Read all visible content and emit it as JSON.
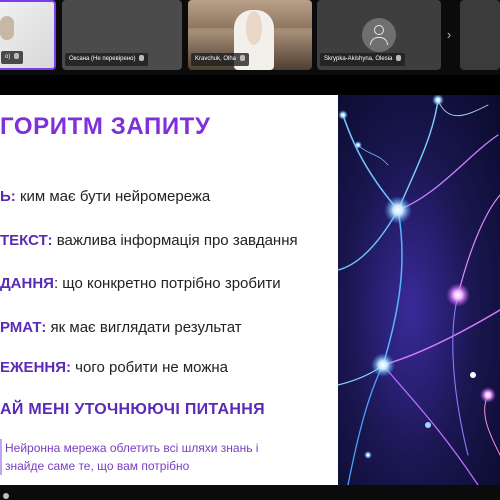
{
  "participants": [
    {
      "name": "o)"
    },
    {
      "name": "Оксана (Не перевірено)"
    },
    {
      "name": "Kravchuk, Olha"
    },
    {
      "name": "Skrypka-Akishyna, Olesia"
    }
  ],
  "strip_next": "›",
  "slide": {
    "title": "ГОРИТМ ЗАПИТУ",
    "rows": [
      {
        "key": "Ь:",
        "text": " ким має бути нейромережа"
      },
      {
        "key": "ТЕКСТ:",
        "text": " важлива інформація про завдання"
      },
      {
        "key": "ДАННЯ",
        "text": ": що конкретно потрібно зробити"
      },
      {
        "key": "РМАТ:",
        "text": " як має виглядати результат"
      },
      {
        "key": "ЕЖЕННЯ:",
        "text": " чого робити не можна"
      }
    ],
    "cta": "АЙ МЕНІ УТОЧНЮЮЧІ ПИТАННЯ",
    "note_line1": "Нейронна мережа облетить всі шляхи знань і",
    "note_line2": "знайде саме те, що вам потрібно"
  },
  "colors": {
    "title": "#7e31d8",
    "key": "#5a2bb6",
    "active_speaker_border": "#7b3cf0"
  }
}
